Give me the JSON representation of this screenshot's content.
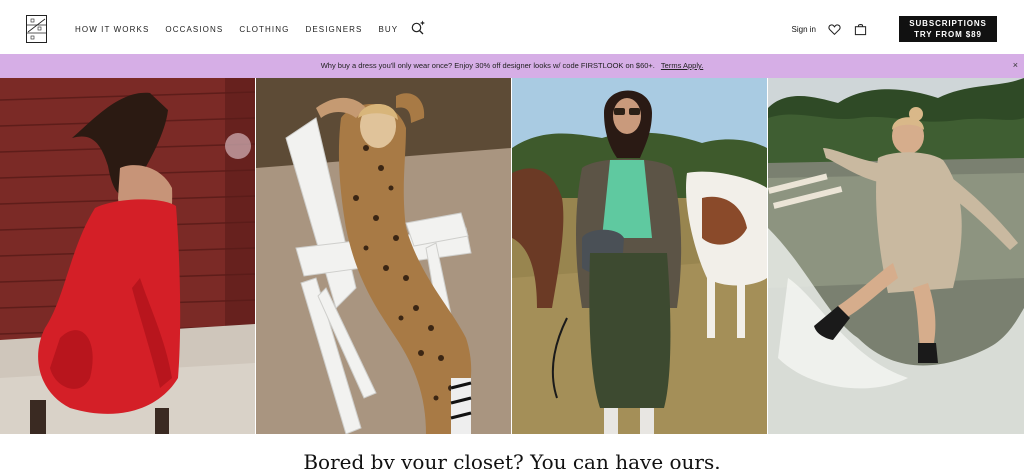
{
  "header": {
    "logo_icon": "rtr-logo-icon",
    "nav": [
      {
        "label": "HOW IT WORKS"
      },
      {
        "label": "OCCASIONS"
      },
      {
        "label": "CLOTHING"
      },
      {
        "label": "DESIGNERS"
      },
      {
        "label": "BUY"
      }
    ],
    "search_icon": "sparkle-search-icon",
    "sign_in": "Sign in",
    "heart_icon": "heart-icon",
    "bag_icon": "shopping-bag-icon",
    "subscriptions": {
      "line1": "SUBSCRIPTIONS",
      "line2": "TRY FROM $89"
    }
  },
  "promo": {
    "text": "Why buy a dress you'll only wear once? Enjoy 30% off designer looks w/ code FIRSTLOOK on $60+.",
    "link": "Terms Apply.",
    "close": "×",
    "background": "#d6aee6"
  },
  "hero": {
    "photos": [
      {
        "name": "woman-red-dress-barn"
      },
      {
        "name": "woman-leopard-print-adirondack-chair"
      },
      {
        "name": "woman-green-skirt-horses"
      },
      {
        "name": "woman-sweater-splashing-lake"
      }
    ]
  },
  "headline": "Bored by your closet? You can have ours."
}
